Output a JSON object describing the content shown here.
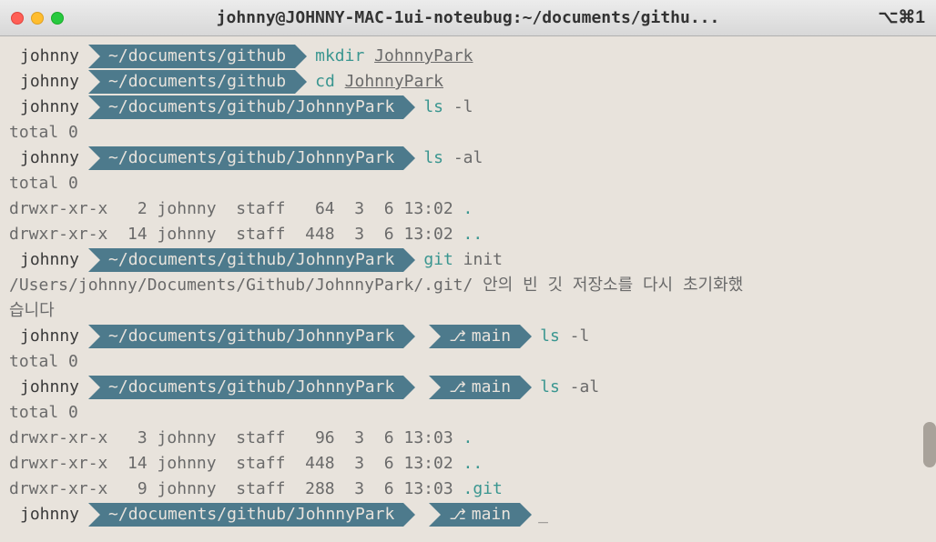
{
  "titlebar": {
    "title": "johnny@JOHNNY-MAC-1ui-noteubug:~/documents/githu...",
    "shortcuts": "⌥⌘1"
  },
  "user": "johnny",
  "path_short": "~/documents/github",
  "path_full": "~/documents/github/JohnnyPark",
  "branch": "main",
  "lines": [
    {
      "type": "prompt",
      "path": "short",
      "cmd": "mkdir",
      "args": "JohnnyPark",
      "args_u": true
    },
    {
      "type": "prompt",
      "path": "short",
      "cmd": "cd",
      "args": "JohnnyPark",
      "args_u": true
    },
    {
      "type": "prompt",
      "path": "full",
      "cmd": "ls",
      "args": "-l"
    },
    {
      "type": "output",
      "text": "total 0"
    },
    {
      "type": "prompt",
      "path": "full",
      "cmd": "ls",
      "args": "-al"
    },
    {
      "type": "output",
      "text": "total 0"
    },
    {
      "type": "output",
      "text": "drwxr-xr-x   2 johnny  staff   64  3  6 13:02 ",
      "tail": ".",
      "tail_teal": true
    },
    {
      "type": "output",
      "text": "drwxr-xr-x  14 johnny  staff  448  3  6 13:02 ",
      "tail": "..",
      "tail_teal": true
    },
    {
      "type": "prompt",
      "path": "full",
      "cmd": "git",
      "args": "init"
    },
    {
      "type": "output",
      "text": "/Users/johnny/Documents/Github/JohnnyPark/.git/ 안의 빈 깃 저장소를 다시 초기화했"
    },
    {
      "type": "output",
      "text": "습니다"
    },
    {
      "type": "prompt",
      "path": "full",
      "branch": true,
      "cmd": "ls",
      "args": "-l"
    },
    {
      "type": "output",
      "text": "total 0"
    },
    {
      "type": "prompt",
      "path": "full",
      "branch": true,
      "cmd": "ls",
      "args": "-al"
    },
    {
      "type": "output",
      "text": "total 0"
    },
    {
      "type": "output",
      "text": "drwxr-xr-x   3 johnny  staff   96  3  6 13:03 ",
      "tail": ".",
      "tail_teal": true
    },
    {
      "type": "output",
      "text": "drwxr-xr-x  14 johnny  staff  448  3  6 13:02 ",
      "tail": "..",
      "tail_teal": true
    },
    {
      "type": "output",
      "text": "drwxr-xr-x   9 johnny  staff  288  3  6 13:03 ",
      "tail": ".git",
      "tail_teal": true
    },
    {
      "type": "prompt",
      "path": "full",
      "branch": true,
      "cursor": true
    }
  ]
}
